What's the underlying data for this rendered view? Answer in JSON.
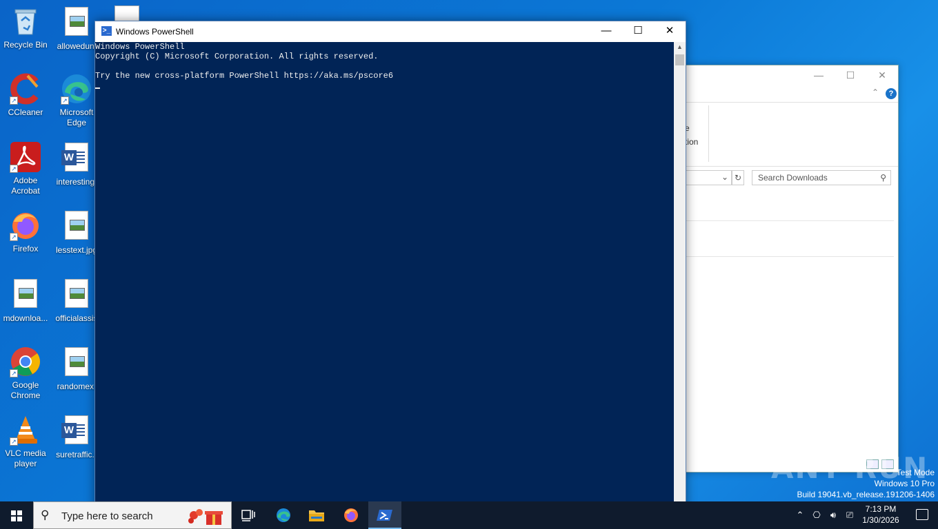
{
  "desktop": {
    "icons": [
      {
        "label": "Recycle Bin"
      },
      {
        "label": "allowedunl"
      },
      {
        "label": "CCleaner"
      },
      {
        "label": "Microsoft Edge"
      },
      {
        "label": "Adobe Acrobat"
      },
      {
        "label": "interesting."
      },
      {
        "label": "Firefox"
      },
      {
        "label": "lesstext.jpg"
      },
      {
        "label": "mdownloa..."
      },
      {
        "label": "officialassis"
      },
      {
        "label": "Google Chrome"
      },
      {
        "label": "randomex."
      },
      {
        "label": "VLC media player"
      },
      {
        "label": "suretraffic.r"
      }
    ]
  },
  "powershell": {
    "title": "Windows PowerShell",
    "console_lines": [
      "Windows PowerShell",
      "Copyright (C) Microsoft Corporation. All rights reserved.",
      "",
      "Try the new cross-platform PowerShell https://aka.ms/pscore6"
    ],
    "background": "#012456"
  },
  "explorer": {
    "ribbon_partial_1": "e",
    "ribbon_partial_2": "tion",
    "search_placeholder": "Search Downloads"
  },
  "watermark": {
    "line1": "Test Mode",
    "line2": "Windows 10 Pro",
    "line3": "Build 19041.vb_release.191206-1406",
    "brand": "ANY RUN"
  },
  "taskbar": {
    "search_placeholder": "Type here to search",
    "time": "7:13 PM",
    "date": "1/30/2026"
  }
}
